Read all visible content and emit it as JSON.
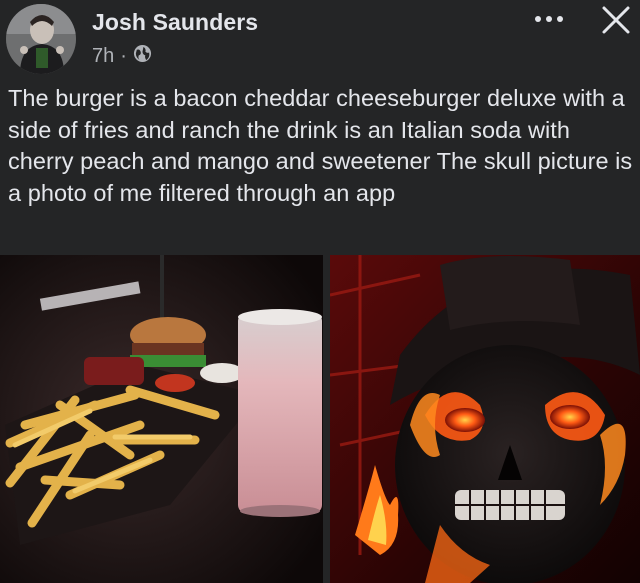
{
  "post": {
    "author": "Josh Saunders",
    "time": "7h",
    "separator": "·",
    "audience_icon": "globe-icon",
    "text": "The burger is a bacon cheddar cheeseburger deluxe with a side of fries and ranch the drink is an Italian soda with cherry peach and mango and sweetener The skull picture is a photo of me filtered through an app"
  },
  "icons": {
    "more": "more-options-icon",
    "close": "close-icon"
  },
  "colors": {
    "background": "#242526",
    "text_primary": "#e4e6eb",
    "text_secondary": "#b0b3b8"
  }
}
